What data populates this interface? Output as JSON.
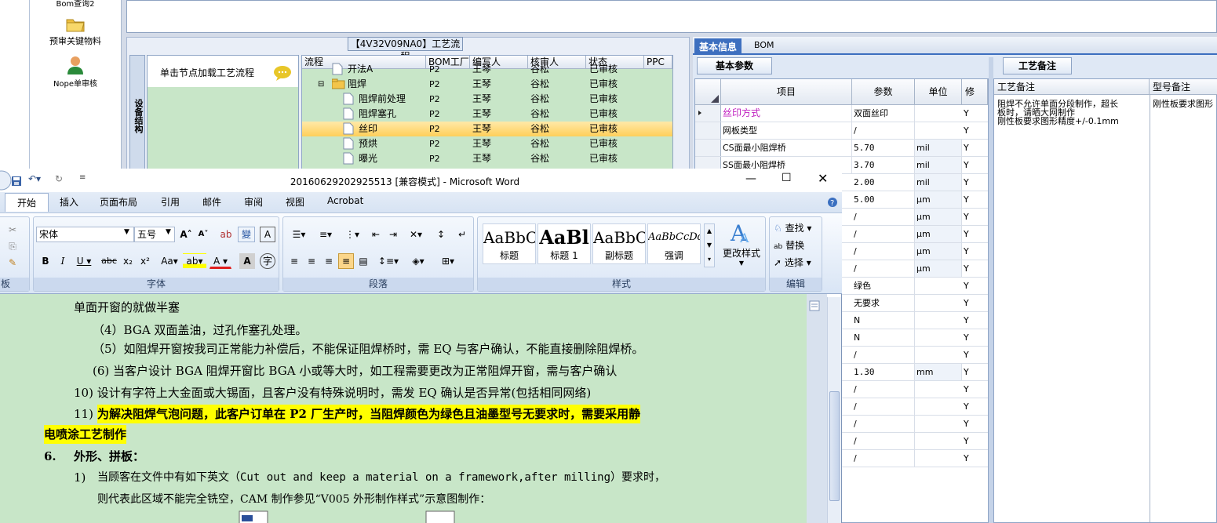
{
  "left_nav": {
    "items": [
      {
        "label": "Bom查询2",
        "icon": "search-icon"
      },
      {
        "label": "预审关键物料",
        "icon": "folder-icon"
      },
      {
        "label": "Nope单审核",
        "icon": "user-icon"
      }
    ]
  },
  "process": {
    "title": "【4V32V09NA0】工艺流程",
    "vertical_tab": "设备结构",
    "hint": "单击节点加载工艺流程",
    "columns": [
      "流程",
      "BOM工厂",
      "编写人",
      "核审人",
      "状态",
      "PPC"
    ],
    "rows": [
      {
        "name": "开法A",
        "factory": "P2",
        "writer": "王琴",
        "reviewer": "谷松",
        "status": "已审核",
        "level": 1,
        "selected": false,
        "folder": false
      },
      {
        "name": "阻焊",
        "factory": "P2",
        "writer": "王琴",
        "reviewer": "谷松",
        "status": "已审核",
        "level": 1,
        "selected": false,
        "folder": true
      },
      {
        "name": "阻焊前处理",
        "factory": "P2",
        "writer": "王琴",
        "reviewer": "谷松",
        "status": "已审核",
        "level": 2,
        "selected": false,
        "folder": false
      },
      {
        "name": "阻焊塞孔",
        "factory": "P2",
        "writer": "王琴",
        "reviewer": "谷松",
        "status": "已审核",
        "level": 2,
        "selected": false,
        "folder": false
      },
      {
        "name": "丝印",
        "factory": "P2",
        "writer": "王琴",
        "reviewer": "谷松",
        "status": "已审核",
        "level": 2,
        "selected": true,
        "folder": false
      },
      {
        "name": "预烘",
        "factory": "P2",
        "writer": "王琴",
        "reviewer": "谷松",
        "status": "已审核",
        "level": 2,
        "selected": false,
        "folder": false
      },
      {
        "name": "曝光",
        "factory": "P2",
        "writer": "王琴",
        "reviewer": "谷松",
        "status": "已审核",
        "level": 2,
        "selected": false,
        "folder": false
      }
    ]
  },
  "right_panel": {
    "tabs": [
      "基本信息",
      "BOM"
    ],
    "subtab_params": "基本参数",
    "subtab_notes": "工艺备注",
    "param_columns": [
      "项目",
      "参数",
      "单位",
      "修"
    ],
    "params": [
      {
        "item": "丝印方式",
        "value": "双面丝印",
        "unit": "",
        "flag": "Y",
        "current": true
      },
      {
        "item": "网板类型",
        "value": "/",
        "unit": "",
        "flag": "Y",
        "current": false
      },
      {
        "item": "CS面最小阻焊桥",
        "value": "5.70",
        "unit": "mil",
        "flag": "Y",
        "current": false
      },
      {
        "item": "SS面最小阻焊桥",
        "value": "3.70",
        "unit": "mil",
        "flag": "Y",
        "current": false
      },
      {
        "item": "",
        "value": "2.00",
        "unit": "mil",
        "flag": "Y",
        "current": false
      },
      {
        "item": "",
        "value": "5.00",
        "unit": "μm",
        "flag": "Y",
        "current": false
      },
      {
        "item": "",
        "value": "/",
        "unit": "μm",
        "flag": "Y",
        "current": false
      },
      {
        "item": "",
        "value": "/",
        "unit": "μm",
        "flag": "Y",
        "current": false
      },
      {
        "item": "",
        "value": "/",
        "unit": "μm",
        "flag": "Y",
        "current": false
      },
      {
        "item": "",
        "value": "/",
        "unit": "μm",
        "flag": "Y",
        "current": false
      },
      {
        "item": "",
        "value": "绿色",
        "unit": "",
        "flag": "Y",
        "current": false
      },
      {
        "item": "",
        "value": "无要求",
        "unit": "",
        "flag": "Y",
        "current": false
      },
      {
        "item": "",
        "value": "N",
        "unit": "",
        "flag": "Y",
        "current": false
      },
      {
        "item": "",
        "value": "N",
        "unit": "",
        "flag": "Y",
        "current": false
      },
      {
        "item": "",
        "value": "/",
        "unit": "",
        "flag": "Y",
        "current": false
      },
      {
        "item": "",
        "value": "1.30",
        "unit": "mm",
        "flag": "Y",
        "current": false
      },
      {
        "item": "",
        "value": "/",
        "unit": "",
        "flag": "Y",
        "current": false
      },
      {
        "item": "",
        "value": "/",
        "unit": "",
        "flag": "Y",
        "current": false
      },
      {
        "item": "",
        "value": "/",
        "unit": "",
        "flag": "Y",
        "current": false
      },
      {
        "item": "",
        "value": "/",
        "unit": "",
        "flag": "Y",
        "current": false
      },
      {
        "item": "",
        "value": "/",
        "unit": "",
        "flag": "Y",
        "current": false
      }
    ],
    "notes_columns": [
      "工艺备注",
      "型号备注"
    ],
    "process_note_lines": [
      "阻焊不允许单面分段制作，超长",
      "板时，请晒大网制作",
      "刚性板要求图形精度+/-0.1mm"
    ],
    "model_note": "刚性板要求图形"
  },
  "word": {
    "title": "20160629202925513 [兼容模式] - Microsoft Word",
    "tabs": [
      "开始",
      "插入",
      "页面布局",
      "引用",
      "邮件",
      "审阅",
      "视图",
      "Acrobat"
    ],
    "font_name": "宋体",
    "font_size": "五号",
    "groups": {
      "font": "字体",
      "paragraph": "段落",
      "styles": "样式",
      "editing": "编辑"
    },
    "styles": [
      {
        "sample": "AaBbC",
        "name": "标题"
      },
      {
        "sample": "AaBl",
        "name": "标题 1"
      },
      {
        "sample": "AaBbC",
        "name": "副标题"
      },
      {
        "sample": "AaBbCcDd",
        "name": "强调"
      }
    ],
    "change_styles": "更改样式",
    "editing": {
      "find": "查找",
      "replace": "替换",
      "select": "选择"
    },
    "doc_lines": [
      "单面开窗的就做半塞",
      "（4）BGA 双面盖油，过孔作塞孔处理。",
      "（5）如阻焊开窗按我司正常能力补偿后，不能保证阻焊桥时，需 EQ 与客户确认，不能直接删除阻焊桥。",
      "(6) 当客户设计 BGA 阻焊开窗比 BGA 小或等大时，如工程需要更改为正常阻焊开窗，需与客户确认",
      "10) 设计有字符上大金面或大锡面，且客户没有特殊说明时，需发 EQ 确认是否异常(包括相同网络)",
      "11)",
      "为解决阻焊气泡问题，此客户订单在 P2 厂生产时，当阻焊颜色为绿色且油墨型号无要求时，需要采用静",
      "电喷涂工艺制作",
      "6.",
      "外形、拼板：",
      "1)",
      "当顾客在文件中有如下英文（Cut out and keep a material on a framework,after milling）要求时，",
      "则代表此区域不能完全铣空，CAM 制作参见“V005 外形制作样式”示意图制作："
    ]
  }
}
